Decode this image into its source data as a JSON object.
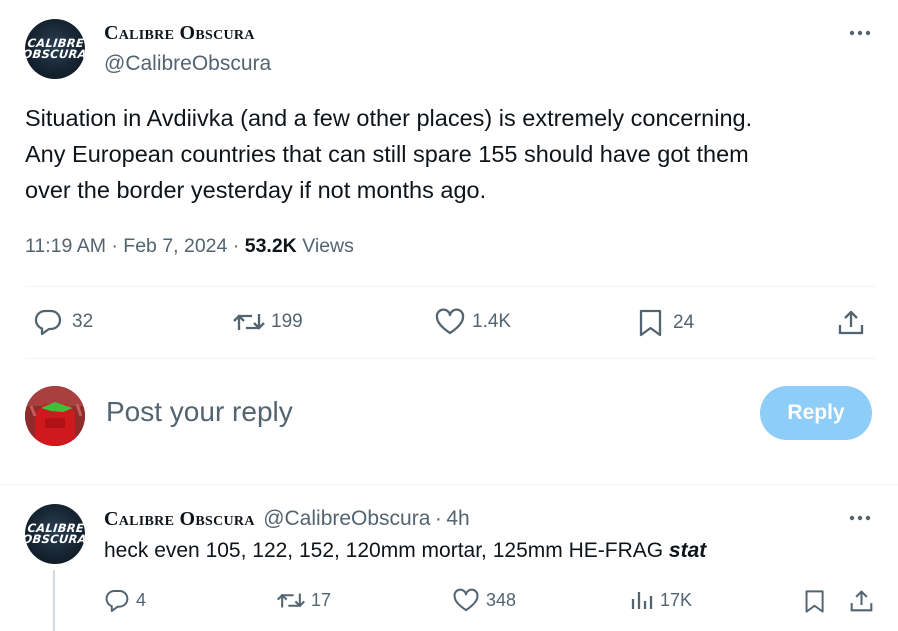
{
  "tweet": {
    "avatar_text_line1": "CALIBRE",
    "avatar_text_line2": "OBSCURA",
    "display_name": "Calibre Obscura",
    "handle": "@CalibreObscura",
    "text_line1": "Situation in Avdiivka (and a few other places) is extremely concerning.",
    "text_line2": "Any European countries that can still spare 155 should have got them",
    "text_line3": "over the border yesterday if not months ago.",
    "time": "11:19 AM",
    "date": "Feb 7, 2024",
    "views_count": "53.2K",
    "views_label": "Views",
    "separator": "·",
    "stats": {
      "replies": "32",
      "reposts": "199",
      "likes": "1.4K",
      "bookmarks": "24"
    }
  },
  "compose": {
    "placeholder": "Post your reply",
    "reply_button": "Reply"
  },
  "reply": {
    "avatar_text_line1": "CALIBRE",
    "avatar_text_line2": "OBSCURA",
    "display_name": "Calibre Obscura",
    "handle": "@CalibreObscura",
    "separator": "·",
    "age": "4h",
    "text_plain": "heck even 105, 122, 152, 120mm mortar, 125mm HE-FRAG ",
    "text_emphasis": "stat",
    "stats": {
      "replies": "4",
      "reposts": "17",
      "likes": "348",
      "views": "17K"
    }
  },
  "colors": {
    "secondary_text": "#536471",
    "primary_text": "#0f1419",
    "reply_button_bg": "#8ecdf8",
    "divider": "#eff3f4"
  },
  "icons": [
    "more-icon",
    "reply-icon",
    "repost-icon",
    "like-icon",
    "bookmark-icon",
    "share-icon",
    "views-icon"
  ]
}
